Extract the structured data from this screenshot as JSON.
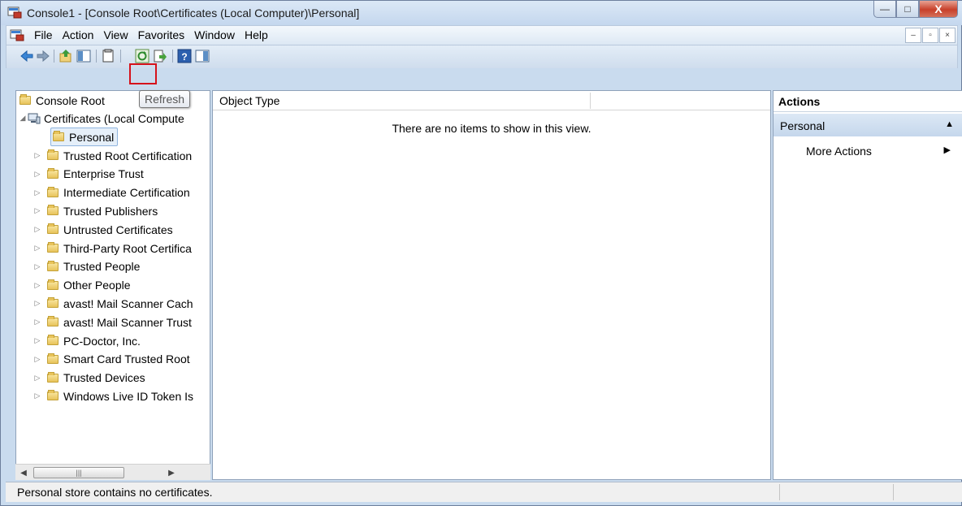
{
  "window": {
    "title": "Console1 - [Console Root\\Certificates (Local Computer)\\Personal]",
    "close_glyph": "X",
    "minimize_glyph": "—",
    "maximize_glyph": "□"
  },
  "menubar": {
    "items": [
      "File",
      "Action",
      "View",
      "Favorites",
      "Window",
      "Help"
    ],
    "mdi_min": "–",
    "mdi_restore": "▫",
    "mdi_close": "×"
  },
  "toolbar": {
    "buttons": [
      "back-icon",
      "forward-icon",
      "up-icon",
      "show-hide-tree-icon",
      "properties-icon",
      "refresh-icon",
      "export-icon",
      "help-icon",
      "show-hide-action-icon"
    ],
    "tooltip": "Refresh",
    "highlighted": "refresh-icon"
  },
  "tree": {
    "root": "Console Root",
    "certificates": "Certificates (Local Compute",
    "selected": "Personal",
    "items": [
      "Trusted Root Certification",
      "Enterprise Trust",
      "Intermediate Certification",
      "Trusted Publishers",
      "Untrusted Certificates",
      "Third-Party Root Certifica",
      "Trusted People",
      "Other People",
      "avast! Mail Scanner Cach",
      "avast! Mail Scanner Trust",
      "PC-Doctor, Inc.",
      "Smart Card Trusted Root",
      "Trusted Devices",
      "Windows Live ID Token Is"
    ],
    "scroll_left": "◀",
    "scroll_right": "▶",
    "scroll_grip": "|||"
  },
  "list": {
    "column": "Object Type",
    "empty_message": "There are no items to show in this view."
  },
  "actions": {
    "title": "Actions",
    "section": "Personal",
    "collapse_glyph": "▲",
    "item": "More Actions",
    "item_arrow": "▶"
  },
  "status": {
    "text": "Personal store contains no certificates."
  },
  "colors": {
    "accent": "#d6121b",
    "title_bg": "#c4d7ee",
    "close_red": "#c7402a"
  }
}
